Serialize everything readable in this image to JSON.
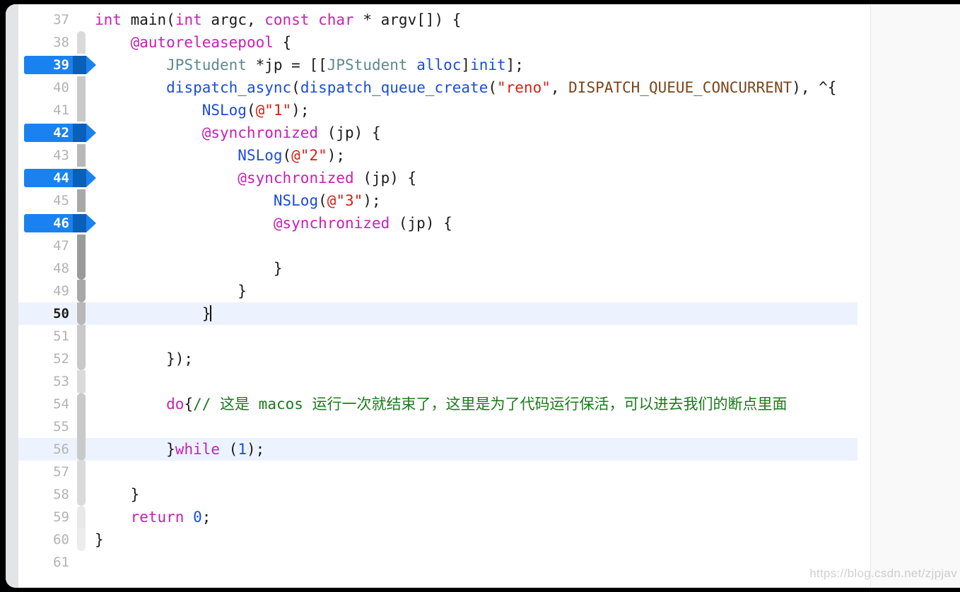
{
  "editor": {
    "language": "Objective-C",
    "current_line": 50,
    "first_visible_line": 37,
    "last_visible_line": 61,
    "breakpoint_lines": [
      39,
      42,
      44,
      46
    ],
    "highlighted_lines": [
      50,
      56
    ],
    "page_guide_column": true,
    "colors": {
      "background": "#ffffff",
      "over_guide_background": "#f9f9f9",
      "gutter_text": "#b3b3b3",
      "current_line_background": "#ecf3fe",
      "breakpoint_blue": "#1a82f0",
      "breakpoint_dark_blue": "#0a5fb8",
      "keyword_magenta": "#c820b4",
      "class_teal": "#5c8a8f",
      "method_blue": "#1b4dd8",
      "string_red": "#d32013",
      "macro_brown": "#7a4518",
      "comment_green": "#1a7a1a",
      "plain_text": "#1a1a1a"
    },
    "lines": [
      {
        "n": "37",
        "text": "int main(int argc, const char * argv[]) {"
      },
      {
        "n": "38",
        "text": "    @autoreleasepool {"
      },
      {
        "n": "39",
        "text": "        JPStudent *jp = [[JPStudent alloc]init];"
      },
      {
        "n": "40",
        "text": "        dispatch_async(dispatch_queue_create(\"reno\", DISPATCH_QUEUE_CONCURRENT), ^{"
      },
      {
        "n": "41",
        "text": "            NSLog(@\"1\");"
      },
      {
        "n": "42",
        "text": "            @synchronized (jp) {"
      },
      {
        "n": "43",
        "text": "                NSLog(@\"2\");"
      },
      {
        "n": "44",
        "text": "                @synchronized (jp) {"
      },
      {
        "n": "45",
        "text": "                    NSLog(@\"3\");"
      },
      {
        "n": "46",
        "text": "                    @synchronized (jp) {"
      },
      {
        "n": "47",
        "text": ""
      },
      {
        "n": "48",
        "text": "                    }"
      },
      {
        "n": "49",
        "text": "                }"
      },
      {
        "n": "50",
        "text": "            }"
      },
      {
        "n": "51",
        "text": ""
      },
      {
        "n": "52",
        "text": "        });"
      },
      {
        "n": "53",
        "text": ""
      },
      {
        "n": "54",
        "text": "        do{// 这是 macos 运行一次就结束了，这里是为了代码运行保活，可以进去我们的断点里面"
      },
      {
        "n": "55",
        "text": ""
      },
      {
        "n": "56",
        "text": "        }while (1);"
      },
      {
        "n": "57",
        "text": ""
      },
      {
        "n": "58",
        "text": "    }"
      },
      {
        "n": "59",
        "text": "    return 0;"
      },
      {
        "n": "60",
        "text": "}"
      },
      {
        "n": "61",
        "text": ""
      }
    ],
    "comment_text": "// 这是 macos 运行一次就结束了，这里是为了代码运行保活，可以进去我们的断点里面"
  },
  "watermark": {
    "text": "https://blog.csdn.net/zjpjav"
  }
}
